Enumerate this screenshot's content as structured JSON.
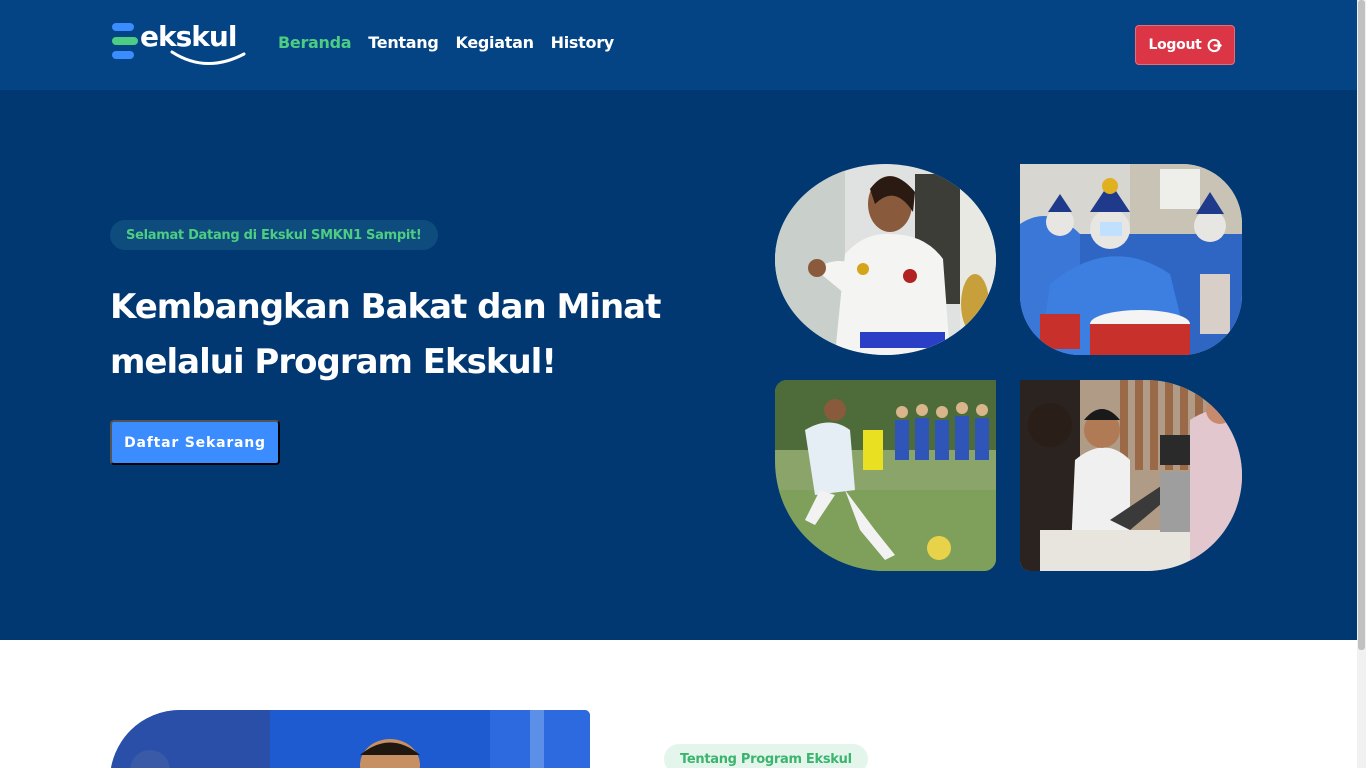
{
  "brand": {
    "name": "ekskul",
    "colors": {
      "navy": "#044384",
      "hero": "#023872",
      "green": "#4ccd83",
      "blue": "#3b8cff",
      "red": "#dc3545"
    }
  },
  "nav": {
    "items": [
      {
        "label": "Beranda",
        "active": true
      },
      {
        "label": "Tentang",
        "active": false
      },
      {
        "label": "Kegiatan",
        "active": false
      },
      {
        "label": "History",
        "active": false
      }
    ],
    "logout_label": "Logout",
    "logout_icon": "logout-icon"
  },
  "hero": {
    "badge": "Selamat Datang di Ekskul SMKN1 Sampit!",
    "title_line1": "Kembangkan Bakat dan Minat",
    "title_line2": "melalui Program Ekskul!",
    "cta_label": "Daftar Sekarang",
    "photos": [
      "karate-photo",
      "marching-band-photo",
      "football-photo",
      "computer-lab-photo"
    ]
  },
  "about": {
    "badge": "Tentang Program Ekskul"
  }
}
